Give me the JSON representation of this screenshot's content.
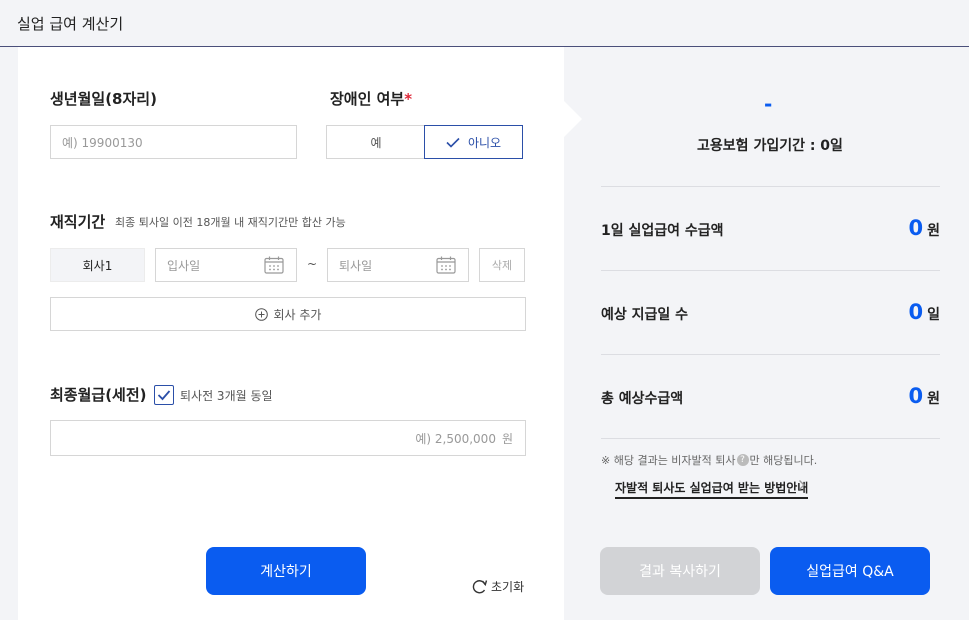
{
  "header": {
    "title": "실업 급여 계산기"
  },
  "birth": {
    "label": "생년월일(8자리)",
    "placeholder": "예) 19900130"
  },
  "disability": {
    "label": "장애인 여부",
    "required_mark": "*",
    "options": [
      "예",
      "아니오"
    ],
    "selected": "아니오"
  },
  "employment": {
    "label": "재직기간",
    "hint": "최종 퇴사일 이전 18개월 내 재직기간만 합산 가능",
    "company": "회사1",
    "start_placeholder": "입사일",
    "tilde": "~",
    "end_placeholder": "퇴사일",
    "delete_label": "삭제",
    "add_label": "회사 추가"
  },
  "salary": {
    "label": "최종월급(세전)",
    "checkbox_label": "퇴사전 3개월 동일",
    "checked": true,
    "placeholder": "예) 2,500,000",
    "unit": "원"
  },
  "actions": {
    "calculate": "계산하기",
    "reset": "초기화"
  },
  "result": {
    "headline": "-",
    "insured_period": "고용보험 가입기간 : 0일",
    "rows": [
      {
        "label": "1일 실업급여 수급액",
        "value": "0",
        "unit": "원"
      },
      {
        "label": "예상 지급일 수",
        "value": "0",
        "unit": "일"
      },
      {
        "label": "총 예상수급액",
        "value": "0",
        "unit": "원"
      }
    ],
    "note_prefix": "※ 해당 결과는 비자발적 퇴사",
    "note_q": "?",
    "note_suffix": "만 해당됩니다.",
    "guide_link": "자발적 퇴사도 실업급여 받는 방법안내",
    "copy_button": "결과 복사하기",
    "qa_button": "실업급여 Q&A"
  },
  "colors": {
    "accent": "#0a5cf0",
    "required": "#e0293a",
    "selected_border": "#2b4fa8",
    "disabled": "#d2d3d6"
  }
}
